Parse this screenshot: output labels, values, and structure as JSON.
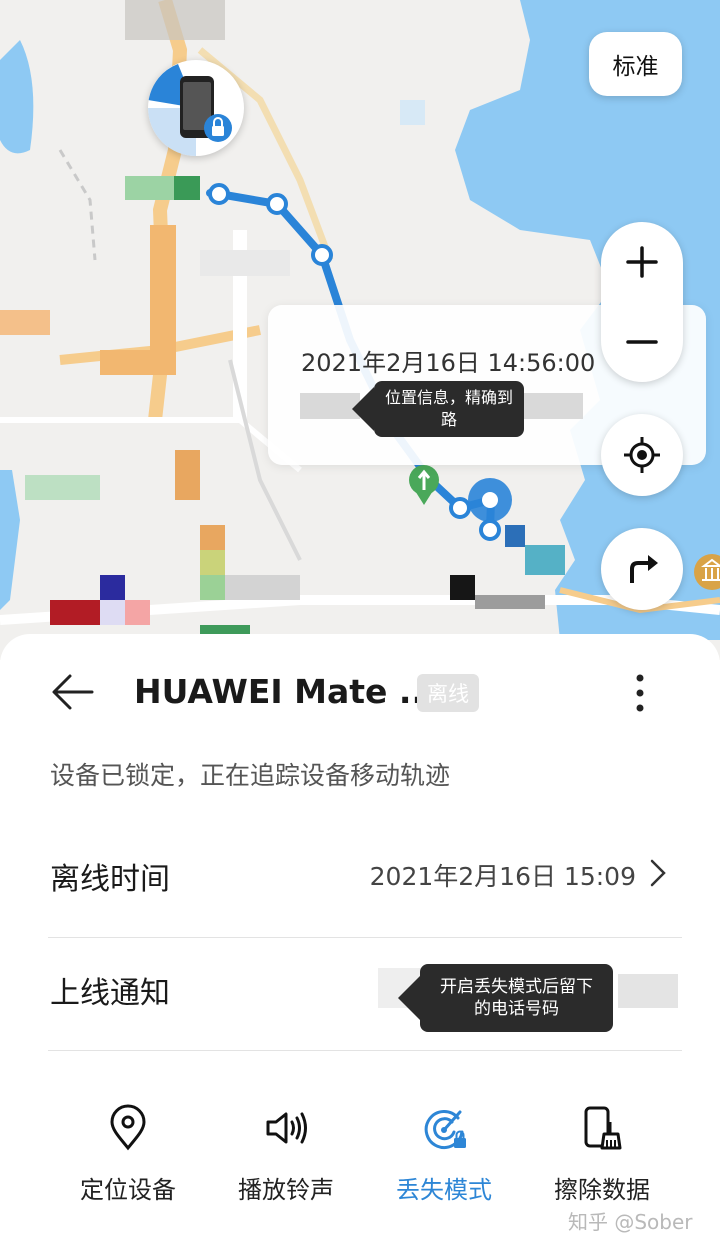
{
  "map": {
    "map_style_label": "标准",
    "zoom_in_label": "+",
    "zoom_out_label": "−",
    "popup": {
      "timestamp": "2021年2月16日 14:56:00"
    },
    "tooltip_location": "位置信息，精确到路"
  },
  "sheet": {
    "device_name": "HUAWEI Mate ...",
    "status_badge": "离线",
    "status_text": "设备已锁定，正在追踪设备移动轨迹",
    "offline_time": {
      "label": "离线时间",
      "value": "2021年2月16日 15:09"
    },
    "online_notify": {
      "label": "上线通知"
    },
    "tooltip_phone": "开启丢失模式后留下的电话号码",
    "actions": [
      {
        "label": "定位设备",
        "icon": "location-pin-icon"
      },
      {
        "label": "播放铃声",
        "icon": "speaker-icon"
      },
      {
        "label": "丢失模式",
        "icon": "lost-mode-radar-icon",
        "active": true
      },
      {
        "label": "擦除数据",
        "icon": "erase-phone-icon"
      }
    ]
  },
  "watermark": "知乎 @Sober",
  "colors": {
    "accent": "#2d86d6",
    "track": "#2a84d8",
    "water": "#8ec9f3"
  }
}
